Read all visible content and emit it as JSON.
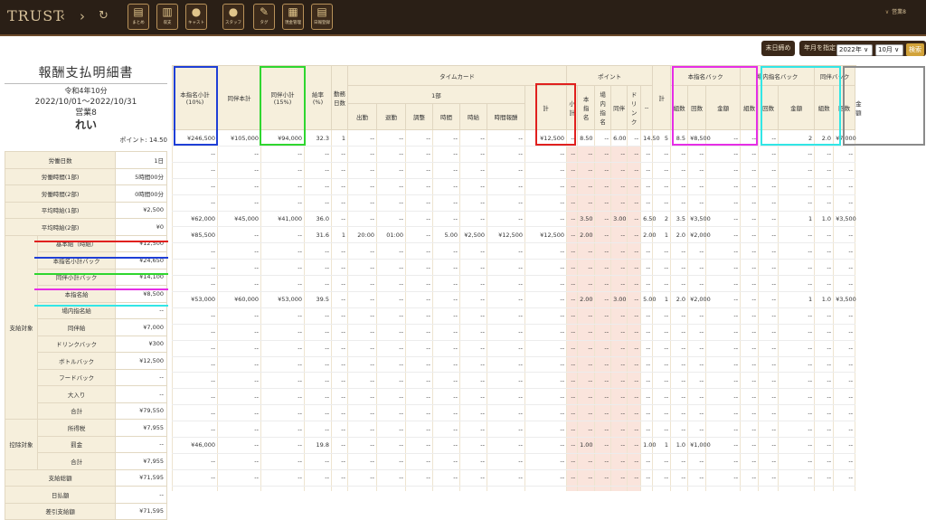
{
  "app": {
    "logo": "TRUST",
    "back_glyph": "‹",
    "forward_glyph": "›",
    "reload_glyph": "↻",
    "user": "営業8",
    "chevron": "∨"
  },
  "toolbar": [
    {
      "label": "まとめ",
      "icon": "summary-icon",
      "glyph": "▤"
    },
    {
      "label": "収支",
      "icon": "chart-icon",
      "glyph": "▥"
    },
    {
      "label": "キャスト",
      "icon": "cast-icon",
      "glyph": "●"
    },
    {
      "label": "スタッフ",
      "icon": "staff-icon",
      "glyph": "●"
    },
    {
      "label": "タグ",
      "icon": "tag-icon",
      "glyph": "✎"
    },
    {
      "label": "現金管理",
      "icon": "cash-icon",
      "glyph": "▦"
    },
    {
      "label": "日報登録",
      "icon": "report-icon",
      "glyph": "▤"
    }
  ],
  "controls": {
    "close_day": "末日締め",
    "period_label": "年月を指定",
    "year": "2022年",
    "month": "10月",
    "search": "検索",
    "dropdown": "∨"
  },
  "statement": {
    "title": "報酬支払明細書",
    "month": "令和4年10分",
    "range": "2022/10/01〜2022/10/31",
    "staff": "営業8",
    "name": "れい",
    "points": "ポイント: 14.50"
  },
  "summary_rows": [
    {
      "label": "労働日数",
      "value": "1日"
    },
    {
      "label": "労働時間(1部)",
      "value": "5時間00分"
    },
    {
      "label": "労働時間(2部)",
      "value": "0時間00分"
    },
    {
      "label": "平均時給(1部)",
      "value": "¥2,500"
    },
    {
      "label": "平均時給(2部)",
      "value": "¥0"
    }
  ],
  "pay_group": "支給対象",
  "pay_rows": [
    {
      "label": "基本給（時給）",
      "value": "¥12,500"
    },
    {
      "label": "本指名小計バック",
      "value": "¥24,650"
    },
    {
      "label": "同伴小計バック",
      "value": "¥14,100"
    },
    {
      "label": "本指名給",
      "value": "¥8,500"
    },
    {
      "label": "場内指名給",
      "value": "--"
    },
    {
      "label": "同伴給",
      "value": "¥7,000"
    },
    {
      "label": "ドリンクバック",
      "value": "¥300"
    },
    {
      "label": "ボトルバック",
      "value": "¥12,500"
    },
    {
      "label": "フードバック",
      "value": "--"
    },
    {
      "label": "大入り",
      "value": "--"
    },
    {
      "label": "合計",
      "value": "¥79,550"
    }
  ],
  "deduct_group": "控除対象",
  "deduct_rows": [
    {
      "label": "所得税",
      "value": "¥7,955"
    },
    {
      "label": "罰金",
      "value": "--"
    },
    {
      "label": "合計",
      "value": "¥7,955"
    }
  ],
  "final_rows": [
    {
      "label": "支給総額",
      "value": "¥71,595"
    },
    {
      "label": "日払額",
      "value": "--"
    },
    {
      "label": "差引支給額",
      "value": "¥71,595"
    }
  ],
  "headers": {
    "hon_sub": "本指名小計\n(10%)",
    "hon_total": "同伴本計",
    "dohan_sub": "同伴小計\n(15%)",
    "rate": "給率\n(%)",
    "days": "勤務\n日数",
    "timecard": "タイムカード",
    "part1": "1部",
    "tc": [
      "出勤",
      "退勤",
      "調整",
      "時間",
      "時給",
      "時間報酬",
      "計"
    ],
    "point": "ポイント",
    "pt": [
      "小\n計",
      "本\n指\n名",
      "場\n内\n指\n名",
      "同伴",
      "ド\nリ\nン\nク",
      "--",
      "計"
    ],
    "honpack": "本指名バック",
    "honpack_cols": [
      "組数",
      "回数",
      "金額"
    ],
    "jonai": "場内指名バック",
    "jonai_cols": [
      "組数",
      "回数",
      "金額"
    ],
    "dohanpack": "同伴バック",
    "dohan_cols": [
      "組数",
      "回数",
      "金額"
    ]
  },
  "total_row": [
    "¥246,500",
    "¥105,000",
    "¥94,000",
    "32.3",
    "1",
    "--",
    "--",
    "--",
    "--",
    "--",
    "--",
    "¥12,500",
    "--",
    "8.50",
    "--",
    "6.00",
    "--",
    "14.50",
    "5",
    "8.5",
    "¥8,500",
    "--",
    "--",
    "--",
    "2",
    "2.0",
    "¥7,000"
  ],
  "rows": [
    [
      "--",
      "--",
      "--",
      "--",
      "--",
      "--",
      "--",
      "--",
      "--",
      "--",
      "--",
      "--",
      "--",
      "--",
      "--",
      "--",
      "--",
      "--",
      "--",
      "--",
      "--",
      "--",
      "--",
      "--",
      "--",
      "--",
      "--"
    ],
    [
      "--",
      "--",
      "--",
      "--",
      "--",
      "--",
      "--",
      "--",
      "--",
      "--",
      "--",
      "--",
      "--",
      "--",
      "--",
      "--",
      "--",
      "--",
      "--",
      "--",
      "--",
      "--",
      "--",
      "--",
      "--",
      "--",
      "--"
    ],
    [
      "--",
      "--",
      "--",
      "--",
      "--",
      "--",
      "--",
      "--",
      "--",
      "--",
      "--",
      "--",
      "--",
      "--",
      "--",
      "--",
      "--",
      "--",
      "--",
      "--",
      "--",
      "--",
      "--",
      "--",
      "--",
      "--",
      "--"
    ],
    [
      "--",
      "--",
      "--",
      "--",
      "--",
      "--",
      "--",
      "--",
      "--",
      "--",
      "--",
      "--",
      "--",
      "--",
      "--",
      "--",
      "--",
      "--",
      "--",
      "--",
      "--",
      "--",
      "--",
      "--",
      "--",
      "--",
      "--"
    ],
    [
      "¥62,000",
      "¥45,000",
      "¥41,000",
      "36.0",
      "--",
      "--",
      "--",
      "--",
      "--",
      "--",
      "--",
      "--",
      "--",
      "3.50",
      "--",
      "3.00",
      "--",
      "6.50",
      "2",
      "3.5",
      "¥3,500",
      "--",
      "--",
      "--",
      "1",
      "1.0",
      "¥3,500"
    ],
    [
      "¥85,500",
      "--",
      "--",
      "31.6",
      "1",
      "20:00",
      "01:00",
      "--",
      "5.00",
      "¥2,500",
      "¥12,500",
      "¥12,500",
      "--",
      "2.00",
      "--",
      "--",
      "--",
      "2.00",
      "1",
      "2.0",
      "¥2,000",
      "--",
      "--",
      "--",
      "--",
      "--",
      "--"
    ],
    [
      "--",
      "--",
      "--",
      "--",
      "--",
      "--",
      "--",
      "--",
      "--",
      "--",
      "--",
      "--",
      "--",
      "--",
      "--",
      "--",
      "--",
      "--",
      "--",
      "--",
      "--",
      "--",
      "--",
      "--",
      "--",
      "--",
      "--"
    ],
    [
      "--",
      "--",
      "--",
      "--",
      "--",
      "--",
      "--",
      "--",
      "--",
      "--",
      "--",
      "--",
      "--",
      "--",
      "--",
      "--",
      "--",
      "--",
      "--",
      "--",
      "--",
      "--",
      "--",
      "--",
      "--",
      "--",
      "--"
    ],
    [
      "--",
      "--",
      "--",
      "--",
      "--",
      "--",
      "--",
      "--",
      "--",
      "--",
      "--",
      "--",
      "--",
      "--",
      "--",
      "--",
      "--",
      "--",
      "--",
      "--",
      "--",
      "--",
      "--",
      "--",
      "--",
      "--",
      "--"
    ],
    [
      "¥53,000",
      "¥60,000",
      "¥53,000",
      "39.5",
      "--",
      "--",
      "--",
      "--",
      "--",
      "--",
      "--",
      "--",
      "--",
      "2.00",
      "--",
      "3.00",
      "--",
      "5.00",
      "1",
      "2.0",
      "¥2,000",
      "--",
      "--",
      "--",
      "1",
      "1.0",
      "¥3,500"
    ],
    [
      "--",
      "--",
      "--",
      "--",
      "--",
      "--",
      "--",
      "--",
      "--",
      "--",
      "--",
      "--",
      "--",
      "--",
      "--",
      "--",
      "--",
      "--",
      "--",
      "--",
      "--",
      "--",
      "--",
      "--",
      "--",
      "--",
      "--"
    ],
    [
      "--",
      "--",
      "--",
      "--",
      "--",
      "--",
      "--",
      "--",
      "--",
      "--",
      "--",
      "--",
      "--",
      "--",
      "--",
      "--",
      "--",
      "--",
      "--",
      "--",
      "--",
      "--",
      "--",
      "--",
      "--",
      "--",
      "--"
    ],
    [
      "--",
      "--",
      "--",
      "--",
      "--",
      "--",
      "--",
      "--",
      "--",
      "--",
      "--",
      "--",
      "--",
      "--",
      "--",
      "--",
      "--",
      "--",
      "--",
      "--",
      "--",
      "--",
      "--",
      "--",
      "--",
      "--",
      "--"
    ],
    [
      "--",
      "--",
      "--",
      "--",
      "--",
      "--",
      "--",
      "--",
      "--",
      "--",
      "--",
      "--",
      "--",
      "--",
      "--",
      "--",
      "--",
      "--",
      "--",
      "--",
      "--",
      "--",
      "--",
      "--",
      "--",
      "--",
      "--"
    ],
    [
      "--",
      "--",
      "--",
      "--",
      "--",
      "--",
      "--",
      "--",
      "--",
      "--",
      "--",
      "--",
      "--",
      "--",
      "--",
      "--",
      "--",
      "--",
      "--",
      "--",
      "--",
      "--",
      "--",
      "--",
      "--",
      "--",
      "--"
    ],
    [
      "--",
      "--",
      "--",
      "--",
      "--",
      "--",
      "--",
      "--",
      "--",
      "--",
      "--",
      "--",
      "--",
      "--",
      "--",
      "--",
      "--",
      "--",
      "--",
      "--",
      "--",
      "--",
      "--",
      "--",
      "--",
      "--",
      "--"
    ],
    [
      "--",
      "--",
      "--",
      "--",
      "--",
      "--",
      "--",
      "--",
      "--",
      "--",
      "--",
      "--",
      "--",
      "--",
      "--",
      "--",
      "--",
      "--",
      "--",
      "--",
      "--",
      "--",
      "--",
      "--",
      "--",
      "--",
      "--"
    ],
    [
      "--",
      "--",
      "--",
      "--",
      "--",
      "--",
      "--",
      "--",
      "--",
      "--",
      "--",
      "--",
      "--",
      "--",
      "--",
      "--",
      "--",
      "--",
      "--",
      "--",
      "--",
      "--",
      "--",
      "--",
      "--",
      "--",
      "--"
    ],
    [
      "¥46,000",
      "--",
      "--",
      "19.8",
      "--",
      "--",
      "--",
      "--",
      "--",
      "--",
      "--",
      "--",
      "--",
      "1.00",
      "--",
      "--",
      "--",
      "1.00",
      "1",
      "1.0",
      "¥1,000",
      "--",
      "--",
      "--",
      "--",
      "--",
      "--"
    ],
    [
      "--",
      "--",
      "--",
      "--",
      "--",
      "--",
      "--",
      "--",
      "--",
      "--",
      "--",
      "--",
      "--",
      "--",
      "--",
      "--",
      "--",
      "--",
      "--",
      "--",
      "--",
      "--",
      "--",
      "--",
      "--",
      "--",
      "--"
    ],
    [
      "--",
      "--",
      "--",
      "--",
      "--",
      "--",
      "--",
      "--",
      "--",
      "--",
      "--",
      "--",
      "--",
      "--",
      "--",
      "--",
      "--",
      "--",
      "--",
      "--",
      "--",
      "--",
      "--",
      "--",
      "--",
      "--",
      "--"
    ],
    [
      "--",
      "--",
      "--",
      "--",
      "--",
      "--",
      "--",
      "--",
      "--",
      "--",
      "--",
      "--",
      "--",
      "--",
      "--",
      "--",
      "--",
      "--",
      "--",
      "--",
      "--",
      "--",
      "--",
      "--",
      "--",
      "--",
      "--"
    ]
  ],
  "colors": {
    "blue": "#1f3fd6",
    "green": "#2fd62f",
    "red": "#e0201e",
    "magenta": "#e62ee6",
    "cyan": "#32e6e6",
    "gray": "#8a8a8a",
    "pink": "#fae4dc",
    "header": "#f6efdc"
  }
}
